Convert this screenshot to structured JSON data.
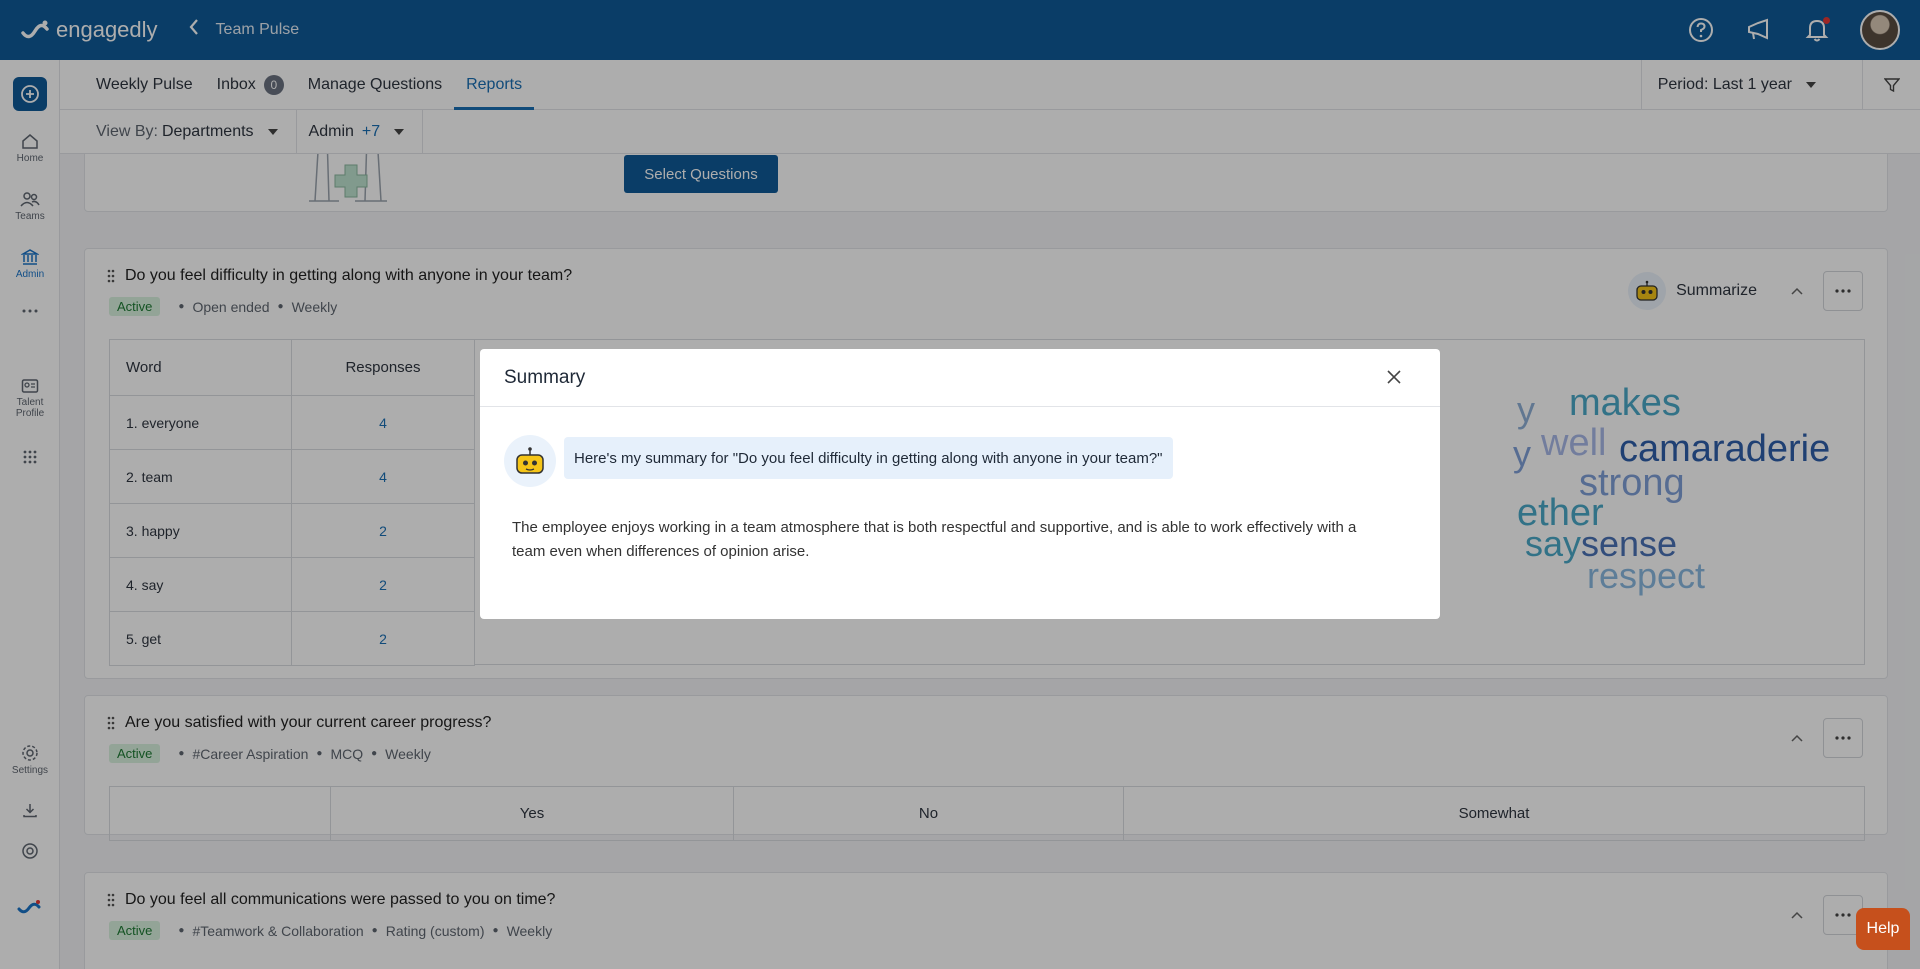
{
  "app": {
    "brand": "engagedly",
    "page_title": "Team Pulse",
    "help_label": "Help"
  },
  "sidebar": {
    "items": [
      {
        "label": "Home",
        "icon": "home-icon"
      },
      {
        "label": "Teams",
        "icon": "teams-icon"
      },
      {
        "label": "Admin",
        "icon": "admin-icon",
        "active": true
      },
      {
        "label": "Talent Profile",
        "icon": "talent-profile-icon"
      },
      {
        "label": "Settings",
        "icon": "gear-icon"
      }
    ]
  },
  "tabs": {
    "items": [
      {
        "label": "Weekly Pulse"
      },
      {
        "label": "Inbox",
        "count": "0"
      },
      {
        "label": "Manage Questions"
      },
      {
        "label": "Reports",
        "active": true
      }
    ],
    "period_label": "Period: Last 1 year"
  },
  "view_by": {
    "prefix": "View By:",
    "value": "Departments",
    "group": "Admin",
    "group_more": "+7"
  },
  "select_questions_label": "Select Questions",
  "questions": [
    {
      "title": "Do you feel difficulty in getting along with anyone in your team?",
      "status": "Active",
      "type": "Open ended",
      "frequency": "Weekly",
      "summarize_label": "Summarize",
      "table": {
        "headers": [
          "Word",
          "Responses"
        ],
        "rows": [
          [
            "1. everyone",
            "4"
          ],
          [
            "2. team",
            "4"
          ],
          [
            "3. happy",
            "2"
          ],
          [
            "4. say",
            "2"
          ],
          [
            "5. get",
            "2"
          ]
        ]
      },
      "cloud_words": [
        {
          "text": "y",
          "color": "#8fb0d6"
        },
        {
          "text": "makes",
          "color": "#4aa8c8"
        },
        {
          "text": "y",
          "color": "#7f9fd8"
        },
        {
          "text": "well",
          "color": "#a9b8e8"
        },
        {
          "text": "camaraderie",
          "color": "#2f5faa"
        },
        {
          "text": "strong",
          "color": "#7f9fd8"
        },
        {
          "text": "ether",
          "color": "#4aa8c8"
        },
        {
          "text": "say",
          "color": "#4aa8c8"
        },
        {
          "text": "sense",
          "color": "#4a72b6"
        },
        {
          "text": "respect",
          "color": "#8ab8e0"
        }
      ]
    },
    {
      "title": "Are you satisfied with your current career progress?",
      "status": "Active",
      "tag": "#Career Aspiration",
      "type": "MCQ",
      "frequency": "Weekly",
      "options": [
        "",
        "Yes",
        "No",
        "Somewhat"
      ]
    },
    {
      "title": "Do you feel all communications were passed to you on time?",
      "status": "Active",
      "tag": "#Teamwork & Collaboration",
      "type": "Rating (custom)",
      "frequency": "Weekly"
    }
  ],
  "modal": {
    "title": "Summary",
    "bubble": "Here's my summary for \"Do you feel difficulty in getting along with anyone in your team?\"",
    "summary": "The employee enjoys working in a team atmosphere that is both respectful and supportive, and is able to work effectively with a team even when differences of opinion arise."
  },
  "colors": {
    "brand": "#0f5b99",
    "accent": "#1a6fb4",
    "active_badge_bg": "#d9f2df",
    "help": "#c6501c"
  }
}
